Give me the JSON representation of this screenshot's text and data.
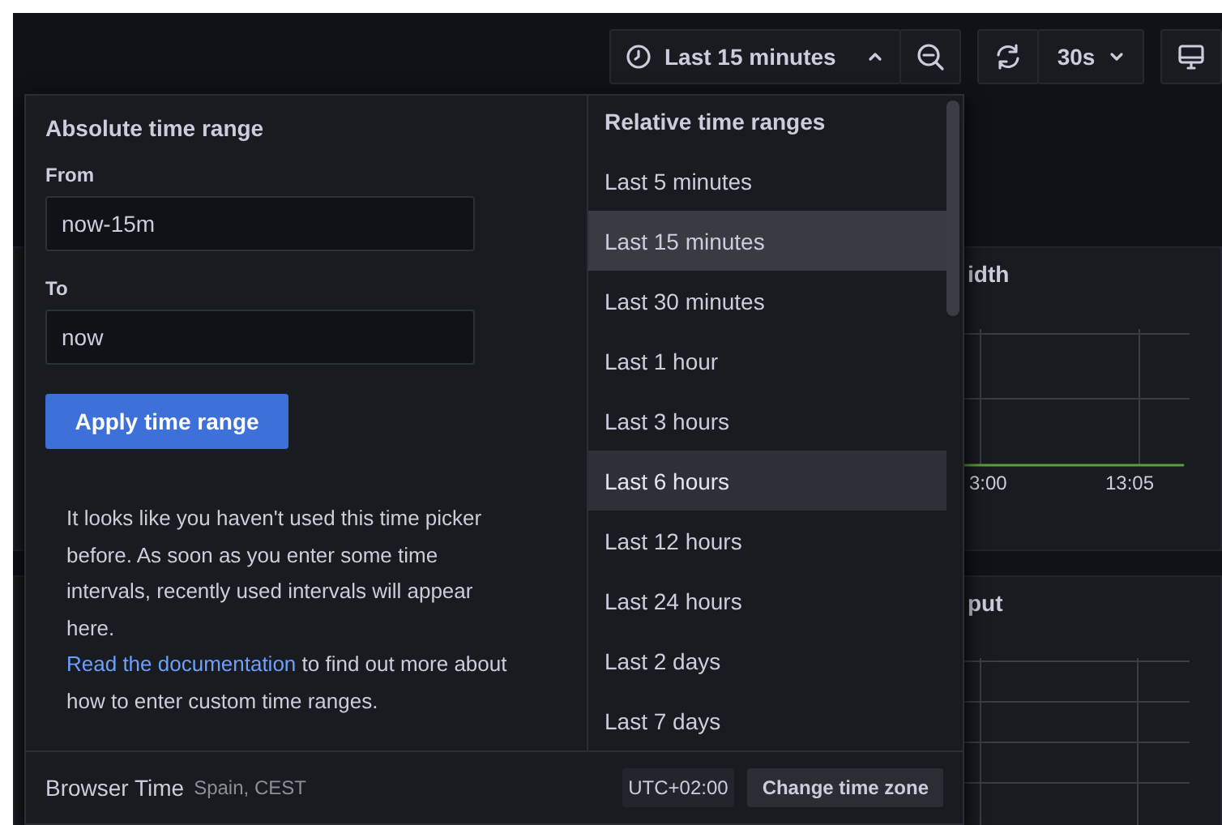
{
  "toolbar": {
    "time_range_label": "Last 15 minutes",
    "picker_open": true,
    "refresh_interval": "30s"
  },
  "panels": [
    {
      "title": "idth",
      "x_ticks": [
        "3:00",
        "13:05"
      ]
    },
    {
      "title": "put"
    }
  ],
  "time_picker": {
    "absolute": {
      "title": "Absolute time range",
      "from_label": "From",
      "from_value": "now-15m",
      "to_label": "To",
      "to_value": "now",
      "apply_button": "Apply time range",
      "info_text": "It looks like you haven't used this time picker before. As soon as you enter some time intervals, recently used intervals will appear here.",
      "doc_link": "Read the documentation",
      "doc_text_after": " to find out more about how to enter custom time ranges."
    },
    "relative": {
      "title": "Relative time ranges",
      "items": [
        {
          "label": "Last 5 minutes",
          "selected": false,
          "hovered": false
        },
        {
          "label": "Last 15 minutes",
          "selected": true,
          "hovered": false
        },
        {
          "label": "Last 30 minutes",
          "selected": false,
          "hovered": false
        },
        {
          "label": "Last 1 hour",
          "selected": false,
          "hovered": false
        },
        {
          "label": "Last 3 hours",
          "selected": false,
          "hovered": false
        },
        {
          "label": "Last 6 hours",
          "selected": false,
          "hovered": true
        },
        {
          "label": "Last 12 hours",
          "selected": false,
          "hovered": false
        },
        {
          "label": "Last 24 hours",
          "selected": false,
          "hovered": false
        },
        {
          "label": "Last 2 days",
          "selected": false,
          "hovered": false
        },
        {
          "label": "Last 7 days",
          "selected": false,
          "hovered": false
        }
      ]
    },
    "footer": {
      "timezone_label": "Browser Time",
      "timezone_detail": "Spain, CEST",
      "utc_offset": "UTC+02:00",
      "change_button": "Change time zone"
    }
  }
}
